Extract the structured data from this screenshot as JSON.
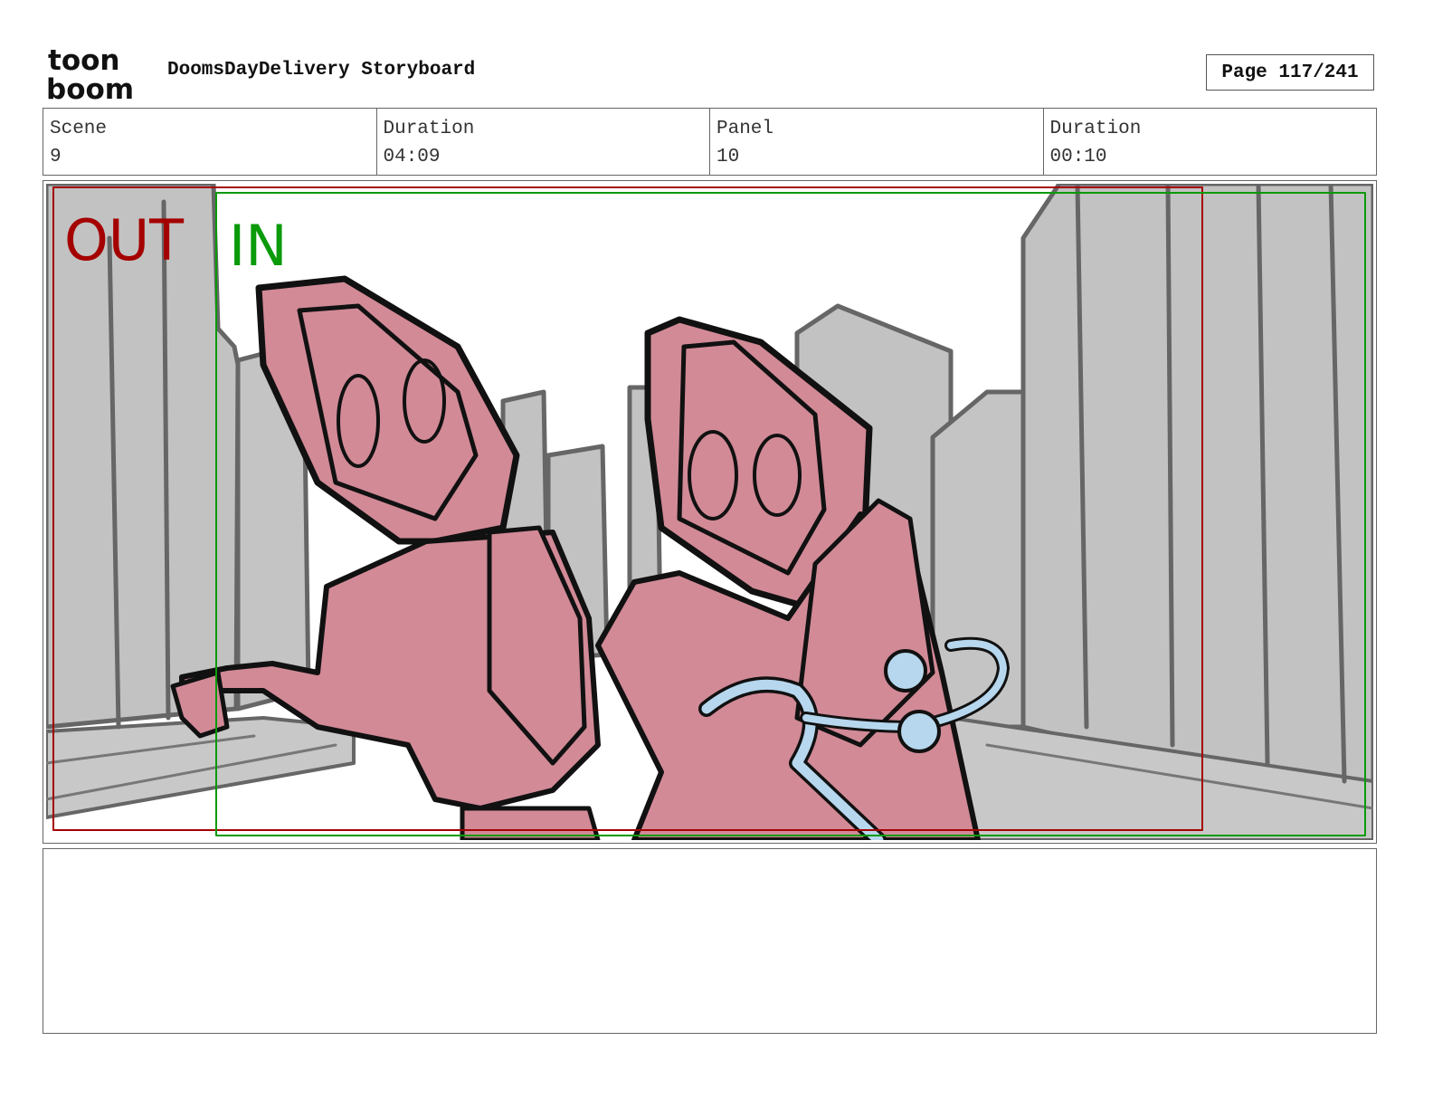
{
  "logo": {
    "line1": "toon",
    "line2": "boom"
  },
  "document": {
    "title": "DoomsDayDelivery Storyboard",
    "page": "Page 117/241"
  },
  "info": {
    "scene_label": "Scene",
    "scene_value": "9",
    "scene_duration_label": "Duration",
    "scene_duration_value": "04:09",
    "panel_label": "Panel",
    "panel_value": "10",
    "panel_duration_label": "Duration",
    "panel_duration_value": "00:10"
  },
  "panel": {
    "out_label": "OUT",
    "in_label": "IN",
    "colors": {
      "out": "#a50000",
      "in": "#0a9a0a",
      "figure": "#d28a97",
      "building": "#c2c2c2",
      "rope": "#b6d7ee"
    }
  },
  "notes": {
    "text": ""
  }
}
